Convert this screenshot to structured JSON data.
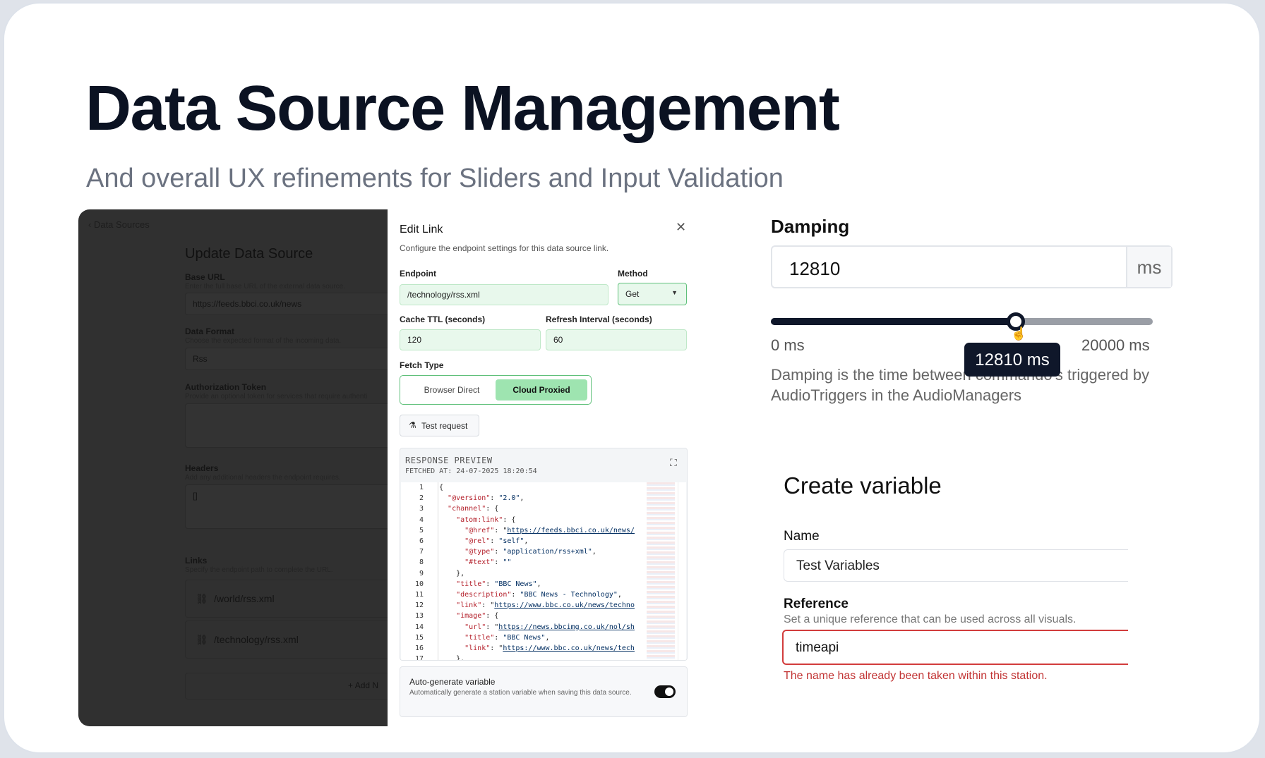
{
  "header": {
    "title": "Data Source Management",
    "subtitle": "And overall UX refinements for Sliders and Input Validation"
  },
  "background_page": {
    "back_label": "Data Sources",
    "title": "Update Data Source",
    "base_url": {
      "label": "Base URL",
      "hint": "Enter the full base URL of the external data source.",
      "value": "https://feeds.bbci.co.uk/news"
    },
    "data_format": {
      "label": "Data Format",
      "hint": "Choose the expected format of the incoming data.",
      "value": "Rss"
    },
    "auth_token": {
      "label": "Authorization Token",
      "hint": "Provide an optional token for services that require authenti"
    },
    "headers": {
      "label": "Headers",
      "hint": "Add any additional headers the endpoint requires.",
      "value": "[]"
    },
    "links": {
      "label": "Links",
      "hint": "Specify the endpoint path to complete the URL.",
      "items": [
        "/world/rss.xml",
        "/technology/rss.xml"
      ],
      "add_label": "Add N"
    }
  },
  "modal": {
    "title": "Edit Link",
    "close_icon": "close-icon",
    "description": "Configure the endpoint settings for this data source link.",
    "endpoint": {
      "label": "Endpoint",
      "value": "/technology/rss.xml"
    },
    "method": {
      "label": "Method",
      "value": "Get"
    },
    "cache_ttl": {
      "label": "Cache TTL (seconds)",
      "value": "120"
    },
    "refresh_interval": {
      "label": "Refresh Interval (seconds)",
      "value": "60"
    },
    "fetch_type": {
      "label": "Fetch Type",
      "options": [
        "Browser Direct",
        "Cloud Proxied"
      ],
      "selected": "Cloud Proxied"
    },
    "test_button": "Test request",
    "response": {
      "title": "RESPONSE PREVIEW",
      "fetched": "FETCHED AT: 24-07-2025 18:20:54",
      "lines": [
        "{",
        "  \"@version\": \"2.0\",",
        "  \"channel\": {",
        "    \"atom:link\": {",
        "      \"@href\": \"https://feeds.bbci.co.uk/news/",
        "      \"@rel\": \"self\",",
        "      \"@type\": \"application/rss+xml\",",
        "      \"#text\": \"\"",
        "    },",
        "    \"title\": \"BBC News\",",
        "    \"description\": \"BBC News - Technology\",",
        "    \"link\": \"https://www.bbc.co.uk/news/techno",
        "    \"image\": {",
        "      \"url\": \"https://news.bbcimg.co.uk/nol/sh",
        "      \"title\": \"BBC News\",",
        "      \"link\": \"https://www.bbc.co.uk/news/tech",
        "    },"
      ]
    },
    "auto_generate": {
      "title": "Auto-generate variable",
      "description": "Automatically generate a station variable when saving this data source.",
      "enabled": true
    }
  },
  "damping": {
    "label": "Damping",
    "value": "12810",
    "unit": "ms",
    "min_label": "0 ms",
    "max_label": "20000 ms",
    "slider_value": 12810,
    "slider_max": 20000,
    "tooltip": "12810 ms",
    "description": "Damping is the time between commando's triggered by AudioTriggers in the AudioManagers"
  },
  "create_variable": {
    "title": "Create variable",
    "name": {
      "label": "Name",
      "value": "Test Variables"
    },
    "reference": {
      "label": "Reference",
      "hint": "Set a unique reference that can be used across all visuals.",
      "value": "timeapi",
      "error": "The name has already been taken within this station."
    }
  },
  "colors": {
    "accent_green": "#9ee4b0",
    "error_red": "#c23535",
    "slider_dark": "#0f172a"
  }
}
